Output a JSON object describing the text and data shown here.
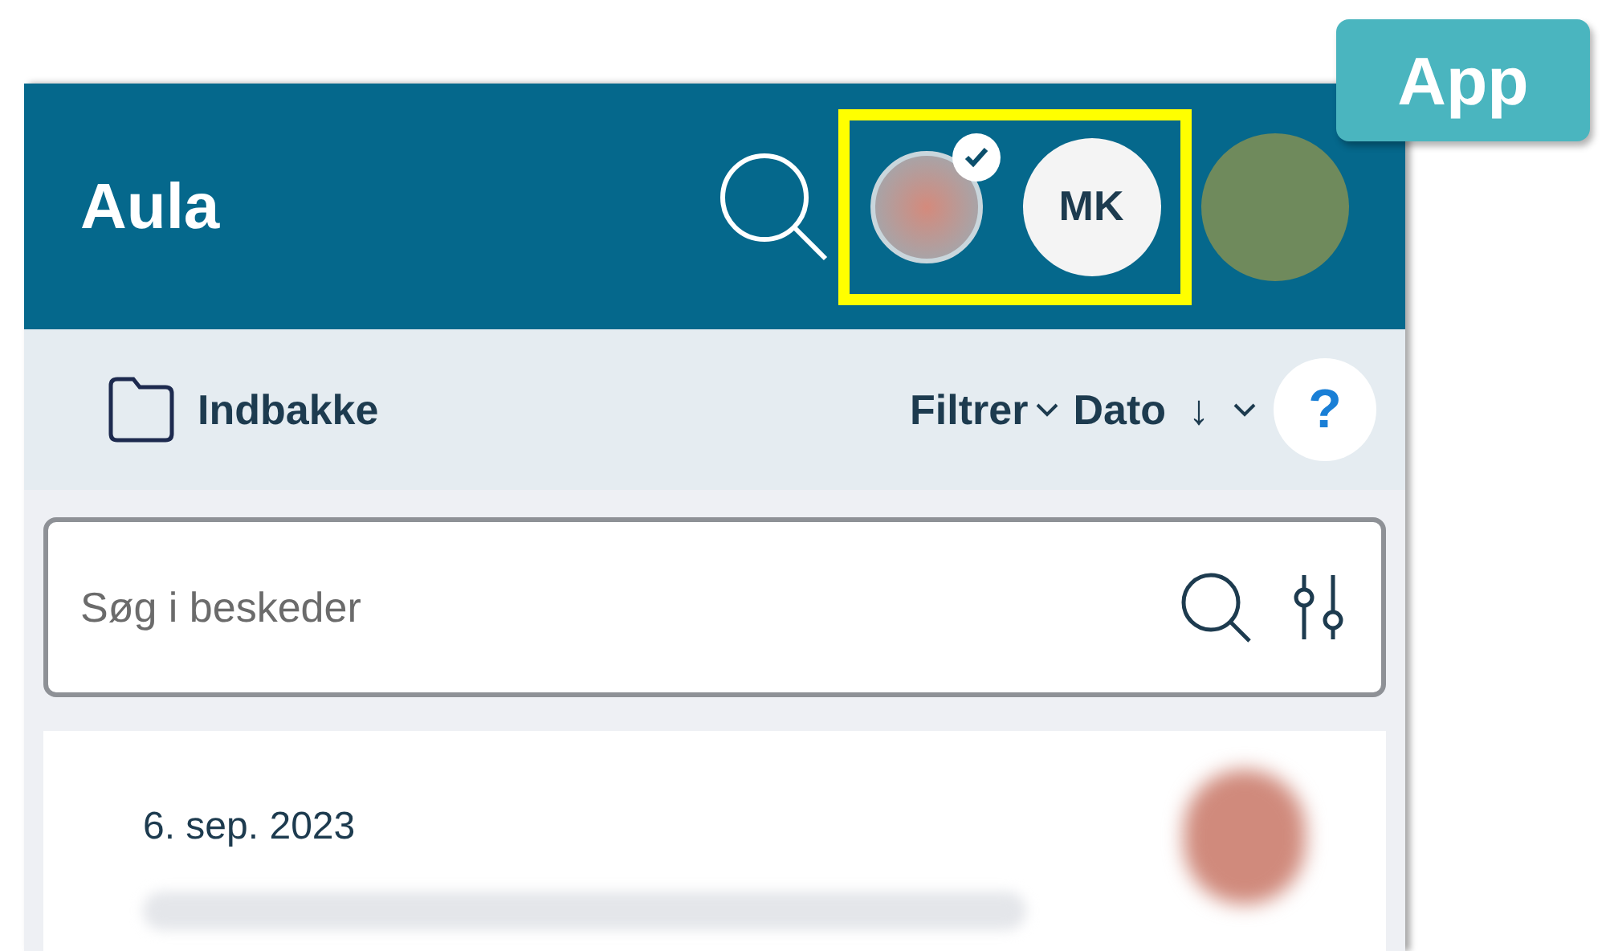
{
  "annotation": {
    "badge": "App",
    "highlight_profiles": true
  },
  "header": {
    "title": "Aula",
    "profiles": [
      {
        "kind": "photo",
        "selected": true
      },
      {
        "kind": "initials",
        "initials": "MK",
        "selected": false
      }
    ]
  },
  "toolbar": {
    "folder": "Indbakke",
    "filter": "Filtrer",
    "sort": "Dato",
    "sort_arrow": "↓",
    "help": "?"
  },
  "search": {
    "placeholder": "Søg i beskeder"
  },
  "messages": [
    {
      "date": "6. sep. 2023"
    }
  ]
}
